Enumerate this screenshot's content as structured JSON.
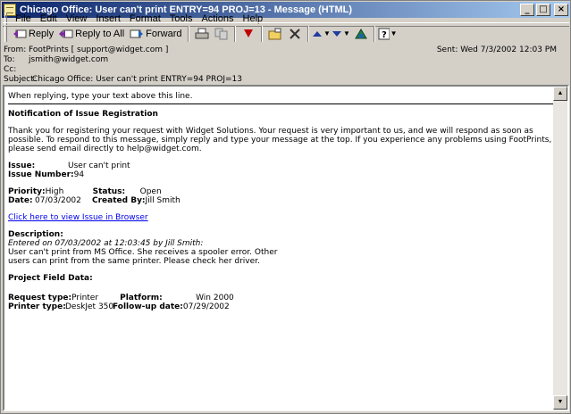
{
  "window": {
    "title": "Chicago Office: User can't print ENTRY=94 PROJ=13 - Message (HTML)",
    "min": "_",
    "max": "□",
    "close": "×"
  },
  "menu": [
    {
      "key": "F",
      "rest": "ile"
    },
    {
      "key": "E",
      "rest": "dit"
    },
    {
      "key": "V",
      "rest": "iew"
    },
    {
      "key": "I",
      "rest": "nsert"
    },
    {
      "key": "o",
      "pre": "F",
      "rest": "rmat"
    },
    {
      "key": "T",
      "rest": "ools"
    },
    {
      "key": "A",
      "rest": "ctions"
    },
    {
      "key": "H",
      "rest": "elp"
    }
  ],
  "toolbar": {
    "reply": "Reply",
    "reply_all": "Reply to All",
    "forward": "Forward"
  },
  "headers": {
    "from_label": "From:",
    "from_value": "FootPrints [ support@widget.com ]",
    "sent_label": "Sent:",
    "sent_value": "Wed 7/3/2002 12:03 PM",
    "to_label": "To:",
    "to_value": "jsmith@widget.com",
    "cc_label": "Cc:",
    "cc_value": "",
    "subject_label": "Subject:",
    "subject_value": "Chicago Office: User can't print ENTRY=94 PROJ=13"
  },
  "message": {
    "reply_line": "When replying, type your text above this line.",
    "heading": "Notification of Issue Registration",
    "intro": "Thank you for registering your request with Widget Solutions. Your request is very important to us, and we will respond as soon as possible. To respond to this message, simply reply and type your message at the top. If you experience any problems using FootPrints, please send email directly to help@widget.com.",
    "issue_label": "Issue:",
    "issue_value": "User can't print",
    "issue_number_label": "Issue Number:",
    "issue_number_value": "94",
    "priority_label": "Priority:",
    "priority_value": "High",
    "status_label": "Status:",
    "status_value": "Open",
    "date_label": "Date:",
    "date_value": "07/03/2002",
    "created_by_label": "Created By:",
    "created_by_value": "Jill Smith",
    "link": "Click here to view Issue in Browser",
    "description_label": "Description:",
    "entered_on": "Entered on 07/03/2002 at 12:03:45 by Jill Smith:",
    "description_line1": "User can't print from MS Office. She receives a spooler error. Other",
    "description_line2": "users can print from the same printer. Please check her driver.",
    "project_field_label": "Project Field Data:",
    "request_type_label": "Request type:",
    "request_type_value": "Printer",
    "platform_label": "Platform:",
    "platform_value": "Win 2000",
    "printer_type_label": "Printer type:",
    "printer_type_value": "DeskJet 350",
    "followup_label": "Follow-up date:",
    "followup_value": "07/29/2002"
  }
}
